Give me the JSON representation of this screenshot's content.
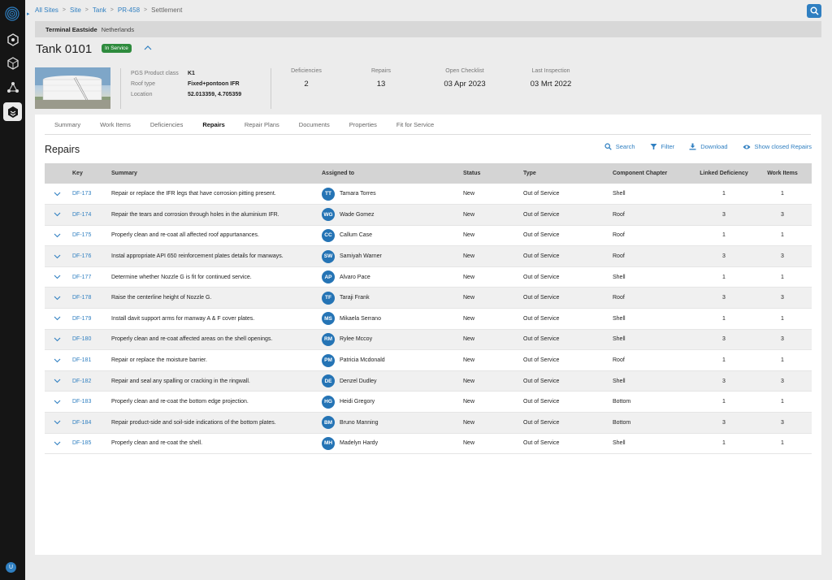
{
  "breadcrumb": {
    "items": [
      "All Sites",
      "Site",
      "Tank",
      "PR-458"
    ],
    "current": "Settlement"
  },
  "site": {
    "name": "Terminal Eastside",
    "country": "Netherlands"
  },
  "asset": {
    "title": "Tank 0101",
    "status": "In Service",
    "properties": [
      {
        "label": "PGS Product class",
        "value": "K1"
      },
      {
        "label": "Roof type",
        "value": "Fixed+pontoon IFR"
      },
      {
        "label": "Location",
        "value": "52.013359, 4.705359"
      }
    ],
    "stats": [
      {
        "label": "Deficiencies",
        "value": "2"
      },
      {
        "label": "Repairs",
        "value": "13"
      },
      {
        "label": "Open Checklist",
        "value": "03 Apr 2023"
      },
      {
        "label": "Last Inspection",
        "value": "03 Mrt 2022"
      }
    ]
  },
  "tabs": [
    "Summary",
    "Work Items",
    "Deficiencies",
    "Repairs",
    "Repair Plans",
    "Documents",
    "Properties",
    "Fit for Service"
  ],
  "active_tab": "Repairs",
  "section": {
    "title": "Repairs",
    "actions": [
      "Search",
      "Filter",
      "Download",
      "Show closed Repairs"
    ]
  },
  "table": {
    "columns": [
      "Key",
      "Summary",
      "Assigned to",
      "Status",
      "Type",
      "Component Chapter",
      "Linked Deficiency",
      "Work Items"
    ],
    "rows": [
      {
        "key": "DF-173",
        "summary": "Repair or replace the IFR legs that have corrosion pitting present.",
        "initials": "TT",
        "assignee": "Tamara Torres",
        "status": "New",
        "type": "Out of Service",
        "chapter": "Shell",
        "linked": "1",
        "work": "1"
      },
      {
        "key": "DF-174",
        "summary": "Repair the tears and corrosion through holes in the aluminium IFR.",
        "initials": "WG",
        "assignee": "Wade Gomez",
        "status": "New",
        "type": "Out of Service",
        "chapter": "Roof",
        "linked": "3",
        "work": "3"
      },
      {
        "key": "DF-175",
        "summary": "Properly clean and re-coat all affected roof appurtanances.",
        "initials": "CC",
        "assignee": "Callum Case",
        "status": "New",
        "type": "Out of Service",
        "chapter": "Roof",
        "linked": "1",
        "work": "1"
      },
      {
        "key": "DF-176",
        "summary": "Instal appropriate API 650 reinforcement plates details for manways.",
        "initials": "SW",
        "assignee": "Samiyah Warner",
        "status": "New",
        "type": "Out of Service",
        "chapter": "Roof",
        "linked": "3",
        "work": "3"
      },
      {
        "key": "DF-177",
        "summary": "Determine whether Nozzle G is fit for continued service.",
        "initials": "AP",
        "assignee": "Alvaro Pace",
        "status": "New",
        "type": "Out of Service",
        "chapter": "Shell",
        "linked": "1",
        "work": "1"
      },
      {
        "key": "DF-178",
        "summary": "Raise the centerline height of Nozzle G.",
        "initials": "TF",
        "assignee": "Taraji Frank",
        "status": "New",
        "type": "Out of Service",
        "chapter": "Roof",
        "linked": "3",
        "work": "3"
      },
      {
        "key": "DF-179",
        "summary": "Install davit support arms for manway A & F cover plates.",
        "initials": "MS",
        "assignee": "Mikaela Serrano",
        "status": "New",
        "type": "Out of Service",
        "chapter": "Shell",
        "linked": "1",
        "work": "1"
      },
      {
        "key": "DF-180",
        "summary": "Properly clean and re-coat affected areas on the shell openings.",
        "initials": "RM",
        "assignee": "Rylee Mccoy",
        "status": "New",
        "type": "Out of Service",
        "chapter": "Shell",
        "linked": "3",
        "work": "3"
      },
      {
        "key": "DF-181",
        "summary": "Repair or replace the moisture barrier.",
        "initials": "PM",
        "assignee": "Patricia Mcdonald",
        "status": "New",
        "type": "Out of Service",
        "chapter": "Roof",
        "linked": "1",
        "work": "1"
      },
      {
        "key": "DF-182",
        "summary": "Repair and seal any spalling or cracking in the ringwall.",
        "initials": "DE",
        "assignee": "Denzel Dudley",
        "status": "New",
        "type": "Out of Service",
        "chapter": "Shell",
        "linked": "3",
        "work": "3"
      },
      {
        "key": "DF-183",
        "summary": "Properly clean and re-coat the bottom edge projection.",
        "initials": "HG",
        "assignee": "Heidi Gregory",
        "status": "New",
        "type": "Out of Service",
        "chapter": "Bottom",
        "linked": "1",
        "work": "1"
      },
      {
        "key": "DF-184",
        "summary": "Repair product-side and soil-side indications of the bottom plates.",
        "initials": "BM",
        "assignee": "Bruno Manning",
        "status": "New",
        "type": "Out of Service",
        "chapter": "Bottom",
        "linked": "3",
        "work": "3"
      },
      {
        "key": "DF-185",
        "summary": "Properly clean and re-coat the shell.",
        "initials": "MH",
        "assignee": "Madelyn Hardy",
        "status": "New",
        "type": "Out of Service",
        "chapter": "Shell",
        "linked": "1",
        "work": "1"
      }
    ]
  },
  "user": {
    "initial": "U"
  },
  "colors": {
    "accent": "#2f7fc1",
    "status_green": "#2e8b3d",
    "rail": "#151515",
    "avatar": "#2574b5"
  },
  "icons": [
    "app-logo-icon",
    "hexagon-icon",
    "cube-icon",
    "network-icon",
    "layers-icon",
    "search-icon",
    "filter-icon",
    "download-icon",
    "eye-icon",
    "chevron-down-icon",
    "chevron-up-icon"
  ]
}
